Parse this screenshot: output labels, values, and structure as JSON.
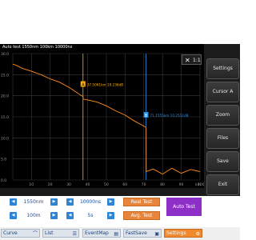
{
  "trace": {
    "title": "Auto test 1550nm 100km 10000ns",
    "zoom_label": "1:1",
    "y_ticks": [
      "30.0",
      "25.0",
      "20.0",
      "15.0",
      "10.0",
      "5.0",
      "0.0"
    ],
    "x_ticks": [
      "10",
      "20",
      "30",
      "40",
      "50",
      "60",
      "70",
      "80",
      "90",
      "100"
    ],
    "x_unit": "km",
    "cursor_a": {
      "label": "A",
      "readout": "37.5061km 19.236dB"
    },
    "cursor_b": {
      "label": "B",
      "readout": "71.1555km 10.2511dB"
    }
  },
  "sidebar": {
    "items": [
      "Settings",
      "Cursor A",
      "Zoom",
      "Files",
      "Save",
      "Exit"
    ]
  },
  "controls": {
    "wavelength": "1550nm",
    "pulse": "10000ns",
    "range": "100m",
    "time": "5s",
    "real_test": "Real Test",
    "avg_test": "Avg. Test",
    "auto_test": "Auto Test"
  },
  "tabs": [
    "Curve",
    "List",
    "EventMap",
    "FastSave",
    "Settings"
  ],
  "colors": {
    "trace": "#ff8c1a",
    "cursor_a": "#ffb000",
    "cursor_b": "#2f8fe6",
    "grid": "#3a3a3a",
    "auto_test_bg": "#8e2fc7",
    "accent_button": "#e8853a",
    "arrow_button": "#2b84d6"
  },
  "chart_data": {
    "type": "line",
    "xlabel": "km",
    "ylabel": "",
    "xlim": [
      0,
      100
    ],
    "ylim": [
      0,
      30
    ],
    "series": [
      {
        "x": [
          0,
          2,
          5,
          10,
          15,
          20,
          25,
          30,
          35,
          37.5,
          37.6,
          40,
          45,
          50,
          55,
          60,
          65,
          70,
          71.2,
          71.3,
          75,
          80,
          85,
          90,
          95,
          100
        ],
        "y": [
          27.5,
          27.2,
          26.5,
          25.8,
          25.0,
          24.0,
          23.2,
          22.0,
          20.5,
          19.8,
          19.2,
          19.0,
          18.5,
          17.6,
          16.4,
          15.4,
          14.0,
          12.8,
          12.5,
          2.0,
          2.6,
          1.4,
          2.8,
          1.6,
          2.5,
          2.0
        ]
      }
    ],
    "markers": [
      {
        "name": "A",
        "x": 37.5061,
        "y": 19.236
      },
      {
        "name": "B",
        "x": 71.1555,
        "y": 10.2511
      }
    ]
  }
}
